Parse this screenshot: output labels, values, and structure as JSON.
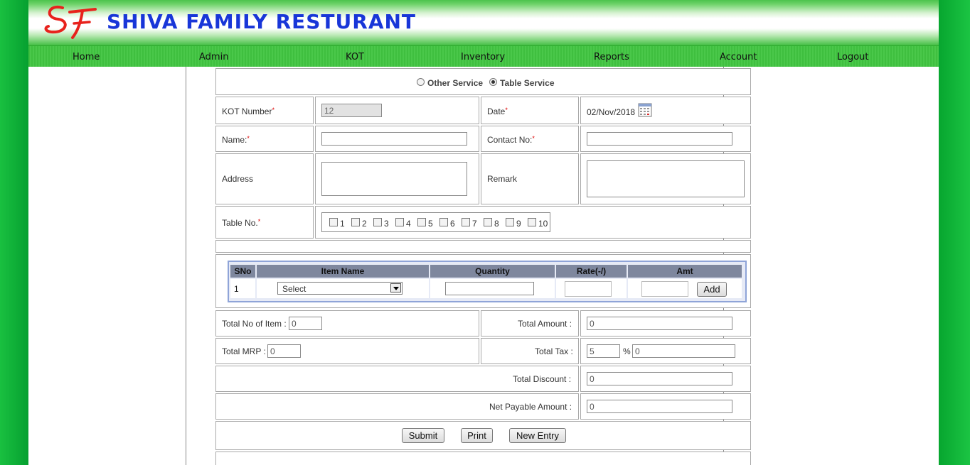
{
  "header": {
    "logo_text": "SF",
    "brand": "SHIVA FAMILY RESTURANT"
  },
  "nav": [
    {
      "label": "Home"
    },
    {
      "label": "Admin"
    },
    {
      "label": "KOT"
    },
    {
      "label": "Inventory"
    },
    {
      "label": "Reports"
    },
    {
      "label": "Account"
    },
    {
      "label": "Logout"
    }
  ],
  "service": {
    "options": [
      "Other Service",
      "Table Service"
    ],
    "selected": "Table Service"
  },
  "form": {
    "kot_label": "KOT Number",
    "kot_value": "12",
    "date_label": "Date",
    "date_value": "02/Nov/2018",
    "name_label": "Name:",
    "name_value": "",
    "contact_label": "Contact No:",
    "contact_value": "",
    "address_label": "Address",
    "address_value": "",
    "remark_label": "Remark",
    "remark_value": "",
    "table_label": "Table No.",
    "required_mark": "*",
    "tables": [
      "1",
      "2",
      "3",
      "4",
      "5",
      "6",
      "7",
      "8",
      "9",
      "10"
    ]
  },
  "items": {
    "headers": [
      "SNo",
      "Item Name",
      "Quantity",
      "Rate(-/)",
      "Amt"
    ],
    "row": {
      "sno": "1",
      "item": "Select",
      "quantity": "",
      "rate": "",
      "amt": ""
    },
    "add_label": "Add"
  },
  "totals": {
    "items_label": "Total No of Item :",
    "items_value": "0",
    "amount_label": "Total Amount :",
    "amount_value": "0",
    "mrp_label": "Total MRP :",
    "mrp_value": "0",
    "tax_label": "Total Tax :",
    "tax_rate": "5",
    "tax_pct": "%",
    "tax_value": "0",
    "discount_label": "Total Discount :",
    "discount_value": "0",
    "net_label": "Net Payable Amount :",
    "net_value": "0"
  },
  "buttons": {
    "submit": "Submit",
    "print": "Print",
    "new_entry": "New Entry"
  },
  "colors": {
    "brand_blue": "#1836d8",
    "logo_red": "#e8221c",
    "nav_green": "#43c043",
    "side_green": "#0aa835",
    "grid_header": "#7e879e"
  }
}
